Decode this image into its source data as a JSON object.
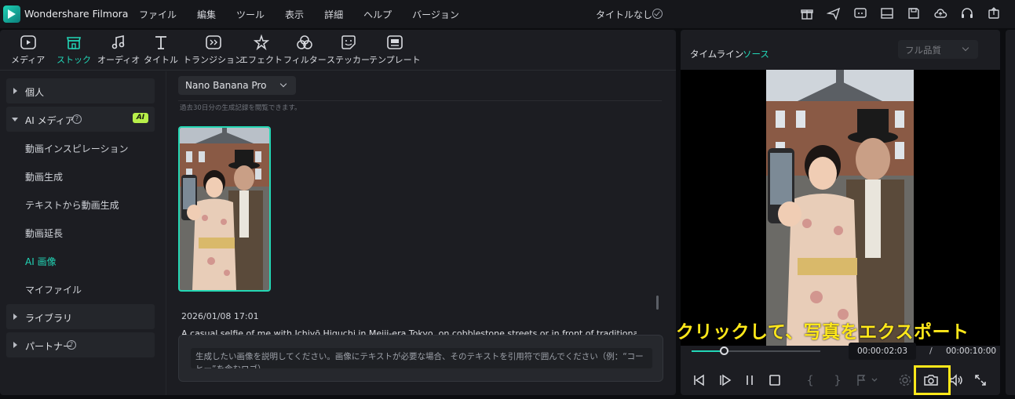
{
  "app": {
    "name": "Wondershare Filmora",
    "menu": [
      "ファイル",
      "編集",
      "ツール",
      "表示",
      "詳細",
      "ヘルプ",
      "バージョン"
    ],
    "doc_title": "タイトルなし",
    "title_icons": [
      "gift-icon",
      "send-icon",
      "chat-icon",
      "layout-icon",
      "save-icon",
      "cloud-icon",
      "headset-icon",
      "export-icon"
    ]
  },
  "toolbar": {
    "items": [
      {
        "label": "メディア",
        "icon": "media-icon"
      },
      {
        "label": "ストック",
        "icon": "stock-icon"
      },
      {
        "label": "オーディオ",
        "icon": "audio-icon"
      },
      {
        "label": "タイトル",
        "icon": "title-icon"
      },
      {
        "label": "トランジション",
        "icon": "transition-icon"
      },
      {
        "label": "エフェクト",
        "icon": "effect-icon"
      },
      {
        "label": "フィルター",
        "icon": "filter-icon"
      },
      {
        "label": "ステッカー",
        "icon": "sticker-icon"
      },
      {
        "label": "テンプレート",
        "icon": "template-icon"
      }
    ],
    "active": "ストック"
  },
  "sidebar": {
    "personal": "個人",
    "ai_media": "AI メディア",
    "ai_badge": "AI",
    "items": [
      "動画インスピレーション",
      "動画生成",
      "テキストから動画生成",
      "動画延長",
      "AI 画像",
      "マイファイル"
    ],
    "active_item": "AI 画像",
    "library": "ライブラリ",
    "partner": "パートナー"
  },
  "content": {
    "model": "Nano Banana Pro",
    "history_hint": "過去30日分の生成記録を閲覧できます。",
    "date": "2026/01/08 17:01",
    "prompt_text": "A casual selfie of me with Ichiyō Higuchi in Meiji-era Tokyo, on cobblestone streets or in front of traditional",
    "input_placeholder": "生成したい画像を説明してください。画像にテキストが必要な場合、そのテキストを引用符で囲んでください（例：“コーヒー”を含むロゴ）"
  },
  "preview": {
    "tab_timeline": "タイムライン",
    "tab_source": "ソース",
    "quality": "フル品質",
    "current_time": "00:00:02:03",
    "separator": "/",
    "total_time": "00:00:10:00",
    "progress": 0.25
  },
  "annotation": {
    "text": "クリックして、写真をエクスポート",
    "color": "#ffe81a"
  },
  "colors": {
    "accent": "#22d6b7",
    "ai_badge": "#b8f04a"
  }
}
